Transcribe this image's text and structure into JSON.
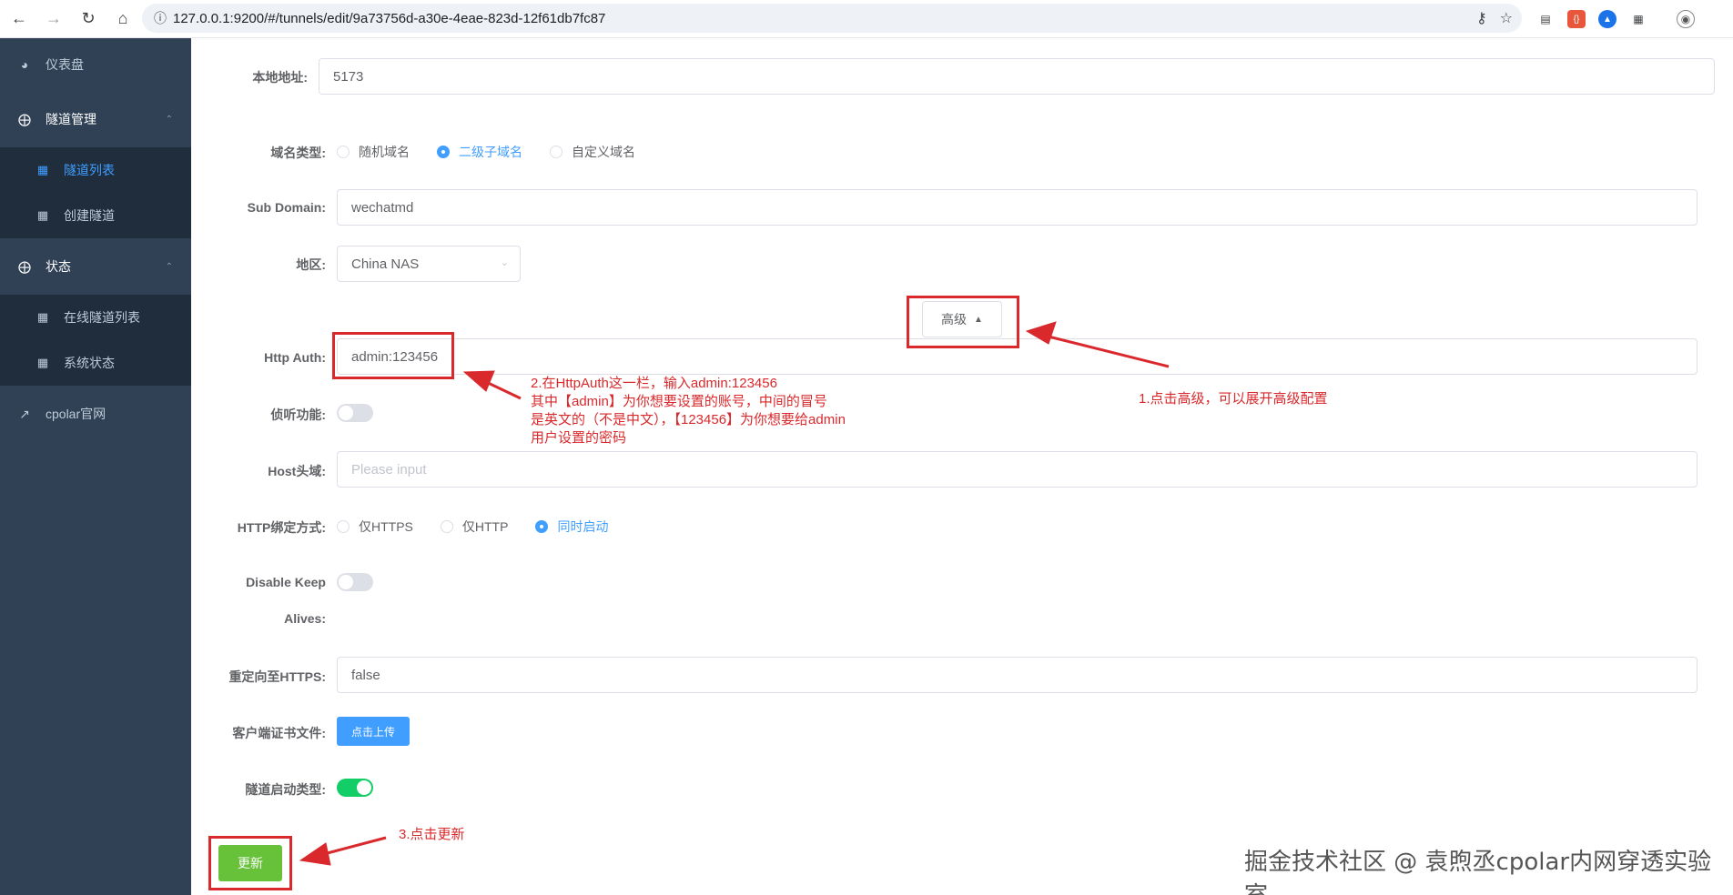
{
  "browser": {
    "url": "127.0.0.1:9200/#/tunnels/edit/9a73756d-a30e-4eae-823d-12f61db7fc87"
  },
  "sidebar": {
    "dashboard": "仪表盘",
    "tunnel_mgmt": "隧道管理",
    "tunnel_list": "隧道列表",
    "create_tunnel": "创建隧道",
    "status": "状态",
    "online_tunnels": "在线隧道列表",
    "system_status": "系统状态",
    "official_site": "cpolar官网"
  },
  "form": {
    "local_addr_label": "本地地址:",
    "local_addr_value": "5173",
    "domain_type_label": "域名类型:",
    "domain_types": [
      "随机域名",
      "二级子域名",
      "自定义域名"
    ],
    "domain_type_selected": "二级子域名",
    "subdomain_label": "Sub Domain:",
    "subdomain_value": "wechatmd",
    "region_label": "地区:",
    "region_value": "China NAS",
    "advanced_label": "高级",
    "http_auth_label": "Http Auth:",
    "http_auth_value": "admin:123456",
    "listen_label": "侦听功能:",
    "host_header_label": "Host头域:",
    "host_header_placeholder": "Please input",
    "bind_mode_label": "HTTP绑定方式:",
    "bind_modes": [
      "仅HTTPS",
      "仅HTTP",
      "同时启动"
    ],
    "bind_mode_selected": "同时启动",
    "keepalive_label_1": "Disable Keep",
    "keepalive_label_2": "Alives:",
    "redirect_label": "重定向至HTTPS:",
    "redirect_value": "false",
    "cert_label": "客户端证书文件:",
    "upload_label": "点击上传",
    "startup_label": "隧道启动类型:",
    "update_label": "更新"
  },
  "annotations": {
    "step1": "1.点击高级，可以展开高级配置",
    "step2_line1": "2.在HttpAuth这一栏，输入admin:123456",
    "step2_line2": "其中【admin】为你想要设置的账号，中间的冒号",
    "step2_line3": "是英文的（不是中文），【123456】为你想要给admin",
    "step2_line4": "用户设置的密码",
    "step3": "3.点击更新"
  },
  "watermark": "掘金技术社区 @ 袁煦丞cpolar内网穿透实验室",
  "colors": {
    "sidebar_bg": "#304156",
    "submenu_bg": "#1f2d3d",
    "primary": "#409eff",
    "success": "#67c23a",
    "switch_on": "#13ce66",
    "annotation": "#d9292c"
  }
}
